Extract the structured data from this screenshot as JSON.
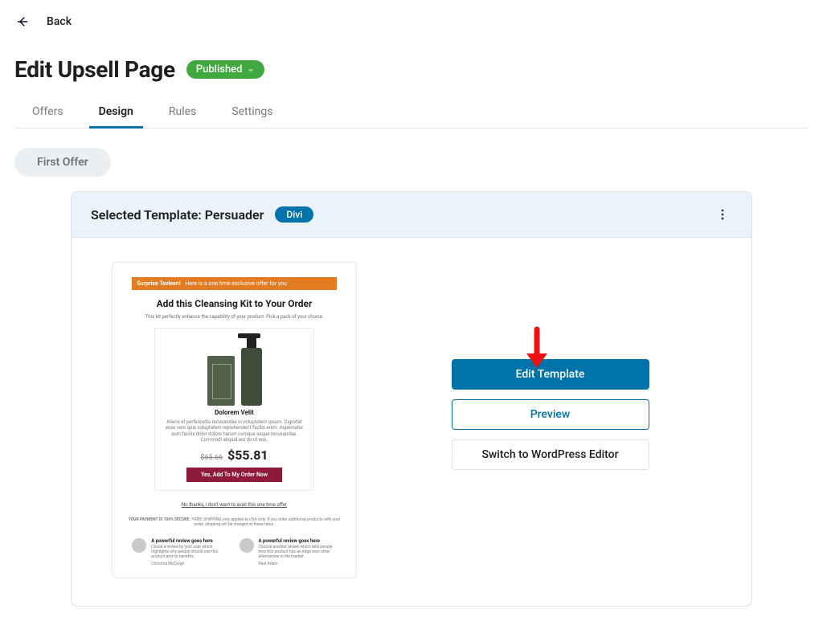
{
  "nav": {
    "back_label": "Back"
  },
  "header": {
    "title": "Edit Upsell Page",
    "status_label": "Published"
  },
  "tabs": [
    {
      "label": "Offers",
      "active": false
    },
    {
      "label": "Design",
      "active": true
    },
    {
      "label": "Rules",
      "active": false
    },
    {
      "label": "Settings",
      "active": false
    }
  ],
  "offer_pill": "First Offer",
  "panel": {
    "title_prefix": "Selected Template: ",
    "template_name": "Persuader",
    "builder_badge": "Divi"
  },
  "actions": {
    "edit": "Edit Template",
    "preview": "Preview",
    "switch": "Switch to WordPress Editor"
  },
  "preview": {
    "banner_bold": "Surprise Tavleen!",
    "banner_rest": "Here is a one time exclusive offer for you",
    "headline": "Add this Cleansing Kit to Your Order",
    "sub": "This kit perfectly enhance the capability of your product. Pick a pack of your choice.",
    "product_name": "Dolorem Velit",
    "desc": "Aliens et perferendis recusandae in voluptatem ipsum. Dignidat esse vero quis voluptatem reprehenderit facilis enim. Aspernatur eum facilis dolor dolore harum cumque eaque recusandae. Commodi aliquid aut do ut eos.",
    "old_price": "$65.66",
    "price": "$55.81",
    "cta": "Yes, Add To My Order Now",
    "skip": "No thanks, I don't want to avail this one time offer",
    "note_bold": "YOUR PAYMENT IS 100% SECURE.",
    "note_rest": "*FREE SHIPPING only applies to USA only. If you order additional products with your order, shipping will be charged at these rates.",
    "reviews": [
      {
        "title": "A powerful review goes here",
        "body": "Chose a review by your user which highlights why people should use this product and its benefits.",
        "name": "Christina McQuigh"
      },
      {
        "title": "A powerful review goes here",
        "body": "Choose another review which tells people how this product has an edge over other alternatives in the market.",
        "name": "Paul Adam"
      }
    ]
  }
}
